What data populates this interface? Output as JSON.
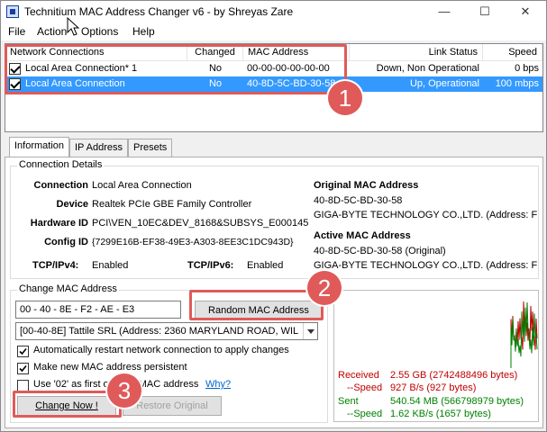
{
  "window": {
    "title": "Technitium MAC Address Changer v6 - by Shreyas Zare"
  },
  "menu": [
    {
      "label": "File"
    },
    {
      "label": "Action"
    },
    {
      "label": "Options"
    },
    {
      "label": "Help"
    }
  ],
  "connections": {
    "columns": [
      "Network Connections",
      "Changed",
      "MAC Address",
      "Link Status",
      "Speed"
    ],
    "rows": [
      {
        "name": "Local Area Connection* 1",
        "changed": "No",
        "mac": "00-00-00-00-00-00",
        "status": "Down, Non Operational",
        "speed": "0 bps",
        "checked": true,
        "selected": false
      },
      {
        "name": "Local Area Connection",
        "changed": "No",
        "mac": "40-8D-5C-BD-30-58",
        "status": "Up, Operational",
        "speed": "100 mbps",
        "checked": true,
        "selected": true
      }
    ]
  },
  "callouts": [
    "1",
    "2",
    "3"
  ],
  "tabs": [
    {
      "label": "Information"
    },
    {
      "label": "IP Address"
    },
    {
      "label": "Presets"
    }
  ],
  "details": {
    "title": "Connection Details",
    "connection_label": "Connection",
    "connection": "Local Area Connection",
    "device_label": "Device",
    "device": "Realtek PCIe GBE Family Controller",
    "hwid_label": "Hardware ID",
    "hwid": "PCI\\VEN_10EC&DEV_8168&SUBSYS_E000145",
    "config_label": "Config ID",
    "config": "{7299E16B-EF38-49E3-A303-8EE3C1DC943D}",
    "tcpv4_label": "TCP/IPv4:",
    "tcpv4": "Enabled",
    "tcpv6_label": "TCP/IPv6:",
    "tcpv6": "Enabled",
    "orig_title": "Original MAC Address",
    "orig_mac": "40-8D-5C-BD-30-58",
    "orig_vendor": "GIGA-BYTE TECHNOLOGY CO.,LTD.  (Address: F",
    "active_title": "Active MAC Address",
    "active_mac": "40-8D-5C-BD-30-58 (Original)",
    "active_vendor": "GIGA-BYTE TECHNOLOGY CO.,LTD.  (Address: F"
  },
  "change": {
    "title": "Change MAC Address",
    "mac_value": "00  -  40  -  8E  -  F2  -  AE  -  E3",
    "random_button": "Random MAC Address",
    "vendor_select": "[00-40-8E] Tattile SRL   (Address: 2360 MARYLAND ROAD, WIL",
    "opt_restart": "Automatically restart network connection to apply changes",
    "opt_persist": "Make new MAC address persistent",
    "opt_02": "Use '02' as first octet of MAC address",
    "why_link": "Why?",
    "change_button": "Change Now !",
    "restore_button": "Restore Original"
  },
  "stats": {
    "received_label": "Received",
    "received": "2.55 GB (2742488496 bytes)",
    "rspeed_label": "--Speed",
    "rspeed": "927 B/s (927 bytes)",
    "sent_label": "Sent",
    "sent": "540.54 MB (566798979 bytes)",
    "sspeed_label": "--Speed",
    "sspeed": "1.62 KB/s (1657 bytes)"
  },
  "colors": {
    "accent": "#3399ff",
    "callout": "#e05a5a",
    "received": "#c00000",
    "sent": "#008000"
  }
}
